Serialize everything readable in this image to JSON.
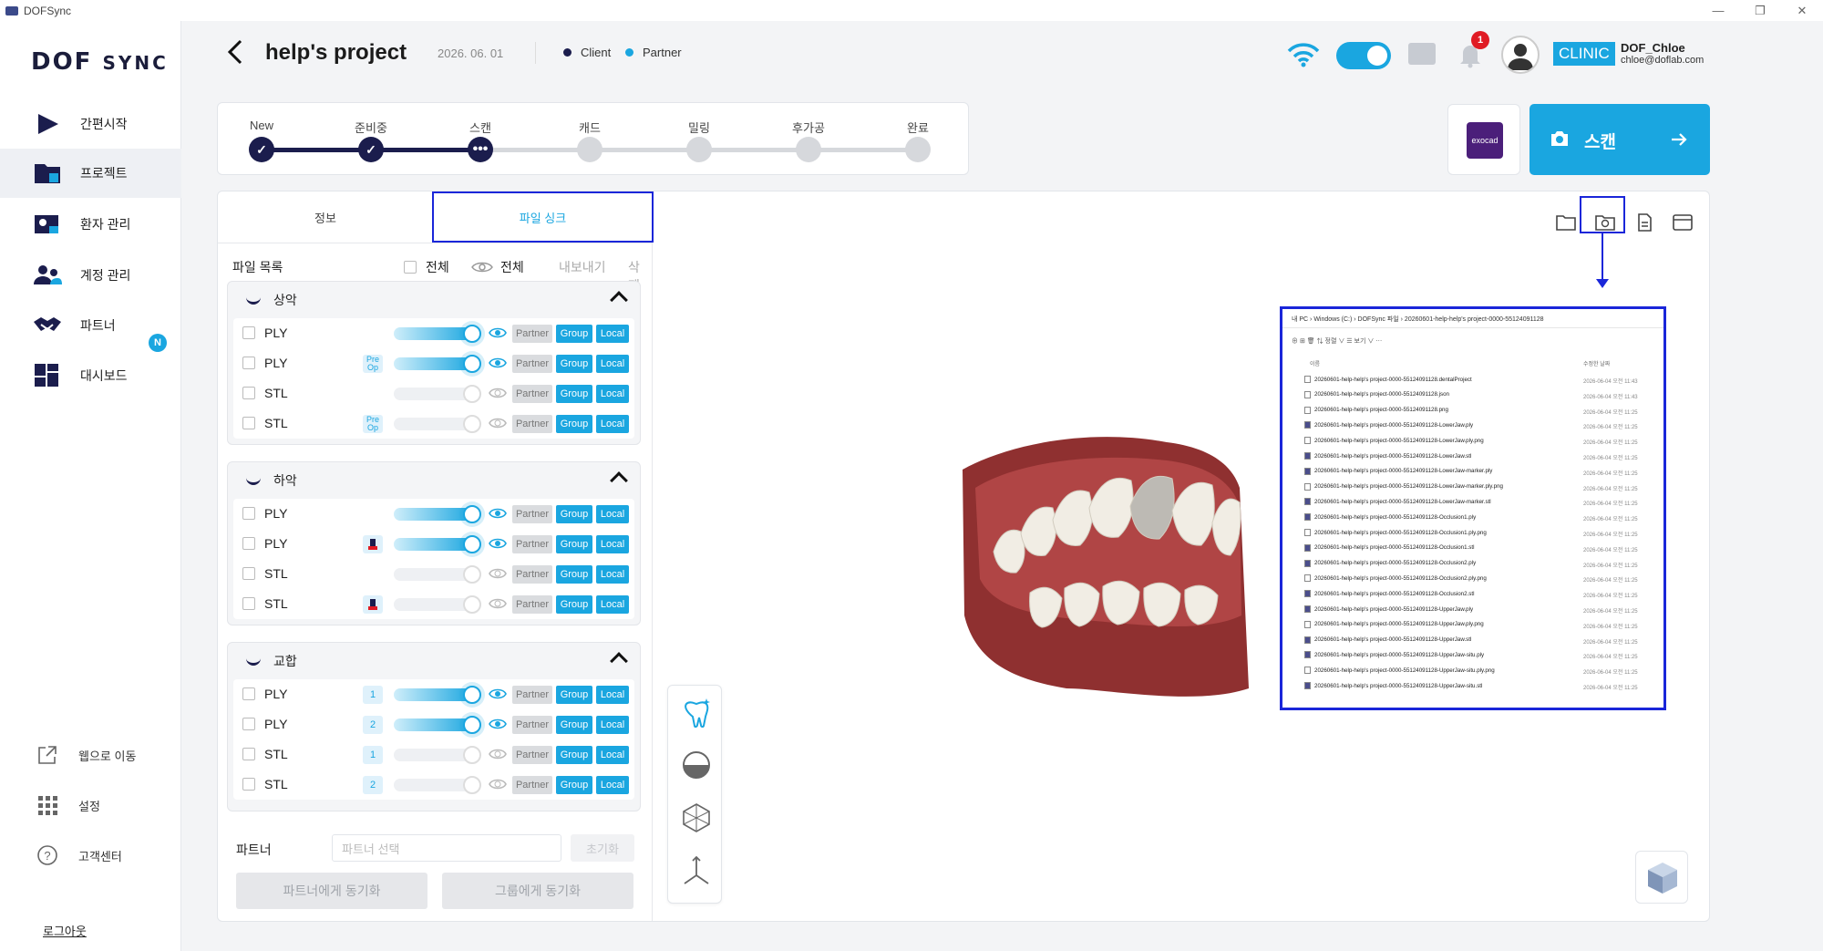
{
  "window": {
    "title": "DOFSync",
    "controls": [
      "—",
      "❐",
      "✕"
    ]
  },
  "sidebar": {
    "logo": "DOF",
    "logo_suffix": "SYNC",
    "items": [
      {
        "label": "간편시작",
        "icon": "play-icon"
      },
      {
        "label": "프로젝트",
        "icon": "folder-icon",
        "active": true
      },
      {
        "label": "환자 관리",
        "icon": "patient-icon"
      },
      {
        "label": "계정 관리",
        "icon": "account-icon"
      },
      {
        "label": "파트너",
        "icon": "handshake-icon",
        "badge": "N"
      },
      {
        "label": "대시보드",
        "icon": "dashboard-icon"
      }
    ],
    "bottom": [
      {
        "label": "웹으로 이동",
        "icon": "external-link-icon"
      },
      {
        "label": "설정",
        "icon": "grid-icon"
      },
      {
        "label": "고객센터",
        "icon": "help-icon"
      }
    ],
    "logout": "로그아웃"
  },
  "header": {
    "title": "help's project",
    "date": "2026. 06. 01",
    "legend_client": "Client",
    "legend_partner": "Partner",
    "notifications": "1",
    "clinic": "CLINIC",
    "user_name": "DOF_Chloe",
    "user_email": "chloe@doflab.com",
    "colors": {
      "accent": "#1aa6e0",
      "navy": "#1b1d4d"
    }
  },
  "progress": {
    "steps": [
      {
        "label": "New",
        "state": "done"
      },
      {
        "label": "준비중",
        "state": "done"
      },
      {
        "label": "스캔",
        "state": "current"
      },
      {
        "label": "캐드",
        "state": "todo"
      },
      {
        "label": "밀링",
        "state": "todo"
      },
      {
        "label": "후가공",
        "state": "todo"
      },
      {
        "label": "완료",
        "state": "todo"
      }
    ]
  },
  "actions": {
    "exocad": "exocad",
    "scan": "스캔"
  },
  "tabs": {
    "info": "정보",
    "file_sync": "파일 싱크"
  },
  "file_list": {
    "title": "파일 목록",
    "select_all": "전체",
    "view_all": "전체",
    "export": "내보내기",
    "delete": "삭제",
    "btn_partner": "Partner",
    "btn_group": "Group",
    "btn_local": "Local"
  },
  "groups": [
    {
      "name": "상악",
      "rows": [
        {
          "type": "PLY",
          "tag": "",
          "on": true
        },
        {
          "type": "PLY",
          "tag": "Pre Op",
          "on": true
        },
        {
          "type": "STL",
          "tag": "",
          "on": false
        },
        {
          "type": "STL",
          "tag": "Pre Op",
          "on": false
        }
      ]
    },
    {
      "name": "하악",
      "rows": [
        {
          "type": "PLY",
          "tag": "",
          "on": true
        },
        {
          "type": "PLY",
          "tag": "impression",
          "on": true
        },
        {
          "type": "STL",
          "tag": "",
          "on": false
        },
        {
          "type": "STL",
          "tag": "impression",
          "on": false
        }
      ]
    },
    {
      "name": "교합",
      "rows": [
        {
          "type": "PLY",
          "tag": "1",
          "on": true
        },
        {
          "type": "PLY",
          "tag": "2",
          "on": true
        },
        {
          "type": "STL",
          "tag": "1",
          "on": false
        },
        {
          "type": "STL",
          "tag": "2",
          "on": false
        }
      ]
    }
  ],
  "partner": {
    "label": "파트너",
    "placeholder": "파트너 선택",
    "reset": "초기화",
    "sync_partner": "파트너에게 동기화",
    "sync_group": "그룹에게 동기화"
  },
  "explorer": {
    "path": "내 PC   ›   Windows (C:)   ›   DOFSync 파일   ›   20260601-help-help's project-0000-55124091128",
    "toolbar": "⊕     ⊞     🗑     ⇅ 정렬 ∨     ☰ 보기 ∨     ⋯",
    "col_name": "이름",
    "col_date": "수정한 날짜",
    "files": [
      {
        "name": "20260601-help-help's project-0000-55124091128.dentalProject",
        "date": "2026-06-04 오전 11:43"
      },
      {
        "name": "20260601-help-help's project-0000-55124091128.json",
        "date": "2026-06-04 오전 11:43"
      },
      {
        "name": "20260601-help-help's project-0000-55124091128.png",
        "date": "2026-06-04 오전 11:25"
      },
      {
        "name": "20260601-help-help's project-0000-55124091128-LowerJaw.ply",
        "date": "2026-06-04 오전 11:25"
      },
      {
        "name": "20260601-help-help's project-0000-55124091128-LowerJaw.ply.png",
        "date": "2026-06-04 오전 11:25"
      },
      {
        "name": "20260601-help-help's project-0000-55124091128-LowerJaw.stl",
        "date": "2026-06-04 오전 11:25"
      },
      {
        "name": "20260601-help-help's project-0000-55124091128-LowerJaw-marker.ply",
        "date": "2026-06-04 오전 11:25"
      },
      {
        "name": "20260601-help-help's project-0000-55124091128-LowerJaw-marker.ply.png",
        "date": "2026-06-04 오전 11:25"
      },
      {
        "name": "20260601-help-help's project-0000-55124091128-LowerJaw-marker.stl",
        "date": "2026-06-04 오전 11:25"
      },
      {
        "name": "20260601-help-help's project-0000-55124091128-Occlusion1.ply",
        "date": "2026-06-04 오전 11:25"
      },
      {
        "name": "20260601-help-help's project-0000-55124091128-Occlusion1.ply.png",
        "date": "2026-06-04 오전 11:25"
      },
      {
        "name": "20260601-help-help's project-0000-55124091128-Occlusion1.stl",
        "date": "2026-06-04 오전 11:25"
      },
      {
        "name": "20260601-help-help's project-0000-55124091128-Occlusion2.ply",
        "date": "2026-06-04 오전 11:25"
      },
      {
        "name": "20260601-help-help's project-0000-55124091128-Occlusion2.ply.png",
        "date": "2026-06-04 오전 11:25"
      },
      {
        "name": "20260601-help-help's project-0000-55124091128-Occlusion2.stl",
        "date": "2026-06-04 오전 11:25"
      },
      {
        "name": "20260601-help-help's project-0000-55124091128-UpperJaw.ply",
        "date": "2026-06-04 오전 11:25"
      },
      {
        "name": "20260601-help-help's project-0000-55124091128-UpperJaw.ply.png",
        "date": "2026-06-04 오전 11:25"
      },
      {
        "name": "20260601-help-help's project-0000-55124091128-UpperJaw.stl",
        "date": "2026-06-04 오전 11:25"
      },
      {
        "name": "20260601-help-help's project-0000-55124091128-UpperJaw-situ.ply",
        "date": "2026-06-04 오전 11:25"
      },
      {
        "name": "20260601-help-help's project-0000-55124091128-UpperJaw-situ.ply.png",
        "date": "2026-06-04 오전 11:25"
      },
      {
        "name": "20260601-help-help's project-0000-55124091128-UpperJaw-situ.stl",
        "date": "2026-06-04 오전 11:25"
      }
    ]
  }
}
